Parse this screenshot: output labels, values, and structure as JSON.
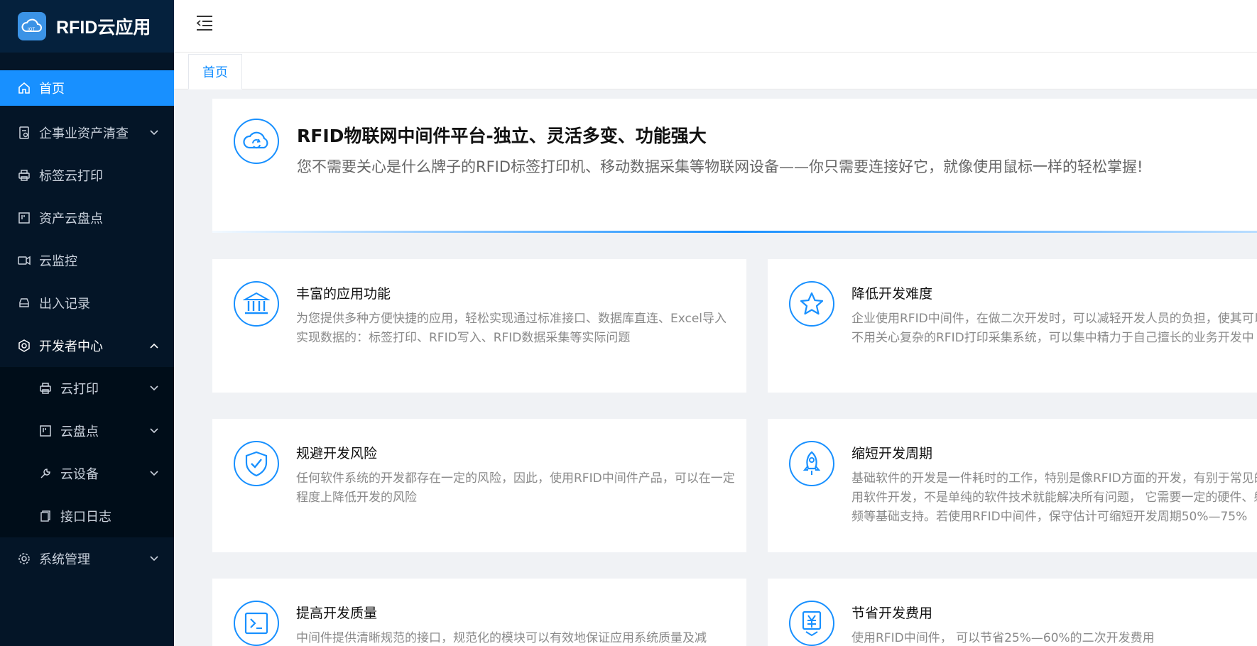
{
  "app": {
    "title": "RFID云应用"
  },
  "sidebar": {
    "items": [
      {
        "label": "首页",
        "icon": "home-icon"
      },
      {
        "label": "企事业资产清查",
        "icon": "document-icon"
      },
      {
        "label": "标签云打印",
        "icon": "printer-icon"
      },
      {
        "label": "资产云盘点",
        "icon": "inventory-icon"
      },
      {
        "label": "云监控",
        "icon": "camera-icon"
      },
      {
        "label": "出入记录",
        "icon": "car-icon"
      },
      {
        "label": "开发者中心",
        "icon": "developer-icon"
      },
      {
        "label": "系统管理",
        "icon": "settings-icon"
      }
    ],
    "sub_items": [
      {
        "label": "云打印",
        "icon": "printer-icon"
      },
      {
        "label": "云盘点",
        "icon": "inventory-icon"
      },
      {
        "label": "云设备",
        "icon": "wrench-icon"
      },
      {
        "label": "接口日志",
        "icon": "log-icon"
      }
    ]
  },
  "tabs": [
    {
      "label": "首页"
    }
  ],
  "hero": {
    "title": "RFID物联网中间件平台-独立、灵活多变、功能强大",
    "subtitle": "您不需要关心是什么牌子的RFID标签打印机、移动数据采集等物联网设备——你只需要连接好它，就像使用鼠标一样的轻松掌握!"
  },
  "cards": [
    {
      "title": "丰富的应用功能",
      "icon": "bank-icon",
      "desc": "为您提供多种方便快捷的应用，轻松实现通过标准接口、数据库直连、Excel导入实现数据的：标签打印、RFID写入、RFID数据采集等实际问题"
    },
    {
      "title": "降低开发难度",
      "icon": "star-icon",
      "lines": [
        "企业使用RFID中间件，在做二次开发时，可以减轻开发人员的负担，使其可以",
        "不用关心复杂的RFID打印采集系统，可以集中精力于自己擅长的业务开发中"
      ]
    },
    {
      "title": "规避开发风险",
      "icon": "shield-check-icon",
      "desc": "任何软件系统的开发都存在一定的风险，因此，使用RFID中间件产品，可以在一定程度上降低开发的风险"
    },
    {
      "title": "缩短开发周期",
      "icon": "rocket-icon",
      "lines": [
        "基础软件的开发是一件耗时的工作，特别是像RFID方面的开发，有别于常见的",
        "用软件开发，不是单纯的软件技术就能解决所有问题， 它需要一定的硬件、射",
        "频等基础支持。若使用RFID中间件，保守估计可缩短开发周期50%—75%"
      ]
    },
    {
      "title": "提高开发质量",
      "icon": "terminal-icon",
      "desc": "中间件提供清晰规范的接口，规范化的模块可以有效地保证应用系统质量及减"
    },
    {
      "title": "节省开发费用",
      "icon": "yen-icon",
      "lines": [
        "使用RFID中间件， 可以节省25%—60%的二次开发费用"
      ]
    }
  ]
}
